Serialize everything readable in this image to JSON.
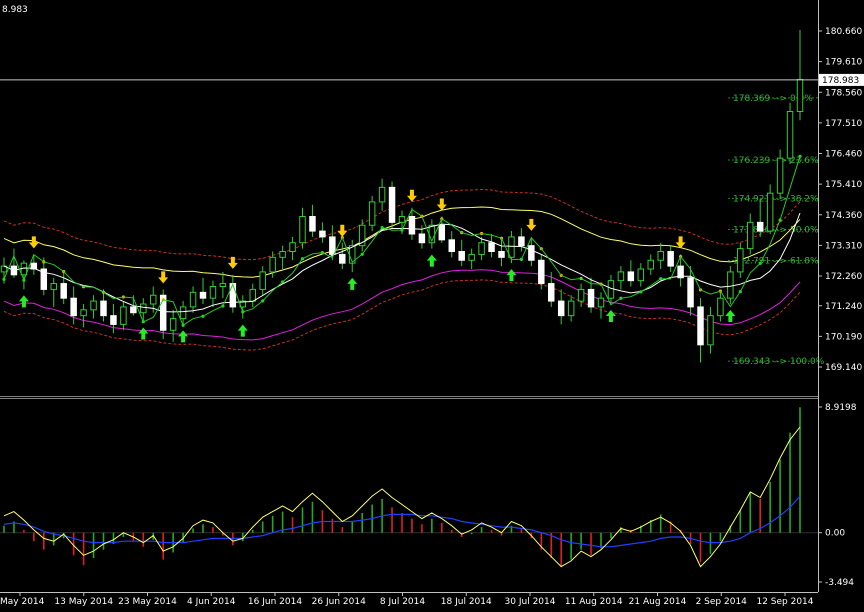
{
  "chart_data": [
    {
      "type": "candlestick",
      "panel": "main",
      "corner_label": "8.983",
      "current_price_label": "178.983",
      "current_price": 178.983,
      "ylim": [
        169.14,
        181.0
      ],
      "y_ticks": [
        "180.660",
        "179.610",
        "178.560",
        "177.510",
        "176.460",
        "175.410",
        "174.360",
        "173.310",
        "172.260",
        "171.240",
        "170.190",
        "169.140"
      ],
      "y_tick_values": [
        180.66,
        179.61,
        178.56,
        177.51,
        176.46,
        175.41,
        174.36,
        173.31,
        172.26,
        171.24,
        170.19,
        169.14
      ],
      "fib_levels": [
        {
          "label": "178.369 --> 0.0%",
          "value": 178.369
        },
        {
          "label": "176.239 --> 23.6%",
          "value": 176.239
        },
        {
          "label": "174.921 --> 38.2%",
          "value": 174.921
        },
        {
          "label": "173.856 --> 50.0%",
          "value": 173.856
        },
        {
          "label": "172.791 --> 61.8%",
          "value": 172.791
        },
        {
          "label": "169.343 --> 100.0%",
          "value": 169.343
        }
      ],
      "candles_ohlc": [
        [
          172.4,
          172.9,
          172.0,
          172.6
        ],
        [
          172.6,
          173.2,
          172.2,
          172.3
        ],
        [
          172.3,
          172.8,
          171.8,
          172.7
        ],
        [
          172.7,
          173.0,
          172.3,
          172.5
        ],
        [
          172.5,
          172.9,
          171.6,
          171.8
        ],
        [
          171.8,
          172.2,
          171.2,
          172.0
        ],
        [
          172.0,
          172.4,
          171.3,
          171.5
        ],
        [
          171.5,
          171.9,
          170.6,
          170.9
        ],
        [
          170.9,
          171.3,
          170.5,
          171.1
        ],
        [
          171.1,
          171.6,
          170.8,
          171.4
        ],
        [
          171.4,
          171.8,
          170.7,
          170.9
        ],
        [
          170.9,
          171.3,
          170.3,
          170.6
        ],
        [
          170.6,
          171.4,
          170.4,
          171.2
        ],
        [
          171.2,
          171.6,
          170.9,
          171.0
        ],
        [
          171.0,
          171.5,
          170.7,
          171.3
        ],
        [
          171.3,
          171.9,
          171.0,
          171.6
        ],
        [
          171.6,
          171.8,
          170.1,
          170.4
        ],
        [
          170.4,
          171.1,
          170.0,
          170.8
        ],
        [
          170.8,
          171.4,
          170.6,
          171.2
        ],
        [
          171.2,
          171.9,
          171.0,
          171.7
        ],
        [
          171.7,
          172.2,
          171.3,
          171.5
        ],
        [
          171.5,
          172.1,
          171.2,
          171.9
        ],
        [
          171.9,
          172.4,
          171.5,
          172.0
        ],
        [
          172.0,
          172.3,
          171.0,
          171.2
        ],
        [
          171.2,
          171.6,
          170.8,
          171.4
        ],
        [
          171.4,
          172.0,
          171.2,
          171.8
        ],
        [
          171.8,
          172.6,
          171.6,
          172.4
        ],
        [
          172.4,
          173.1,
          172.2,
          172.9
        ],
        [
          172.9,
          173.3,
          172.5,
          173.1
        ],
        [
          173.1,
          173.6,
          172.8,
          173.4
        ],
        [
          173.4,
          174.6,
          173.2,
          174.3
        ],
        [
          174.3,
          174.7,
          173.6,
          173.8
        ],
        [
          173.8,
          174.1,
          173.4,
          173.6
        ],
        [
          173.6,
          174.0,
          172.8,
          173.0
        ],
        [
          173.0,
          173.4,
          172.5,
          172.7
        ],
        [
          172.7,
          173.5,
          172.4,
          173.3
        ],
        [
          173.3,
          174.2,
          173.1,
          174.0
        ],
        [
          174.0,
          175.0,
          173.8,
          174.8
        ],
        [
          174.8,
          175.6,
          174.5,
          175.3
        ],
        [
          175.3,
          175.5,
          173.9,
          174.1
        ],
        [
          174.1,
          174.5,
          173.7,
          174.3
        ],
        [
          174.3,
          174.6,
          173.5,
          173.7
        ],
        [
          173.7,
          174.0,
          173.2,
          173.4
        ],
        [
          173.4,
          174.2,
          173.2,
          174.0
        ],
        [
          174.0,
          174.3,
          173.4,
          173.5
        ],
        [
          173.5,
          173.8,
          172.9,
          173.1
        ],
        [
          173.1,
          173.5,
          172.6,
          172.8
        ],
        [
          172.8,
          173.2,
          172.5,
          173.0
        ],
        [
          173.0,
          173.6,
          172.8,
          173.4
        ],
        [
          173.4,
          173.7,
          172.9,
          173.1
        ],
        [
          173.1,
          173.5,
          172.6,
          172.9
        ],
        [
          172.9,
          173.8,
          172.7,
          173.6
        ],
        [
          173.6,
          173.9,
          173.1,
          173.3
        ],
        [
          173.3,
          173.6,
          172.6,
          172.8
        ],
        [
          172.8,
          173.0,
          171.8,
          172.0
        ],
        [
          172.0,
          172.4,
          171.2,
          171.4
        ],
        [
          171.4,
          171.8,
          170.6,
          170.9
        ],
        [
          170.9,
          171.6,
          170.7,
          171.4
        ],
        [
          171.4,
          172.0,
          171.2,
          171.8
        ],
        [
          171.8,
          172.2,
          171.0,
          171.2
        ],
        [
          171.2,
          171.7,
          170.8,
          171.5
        ],
        [
          171.5,
          172.3,
          171.3,
          172.1
        ],
        [
          172.1,
          172.6,
          171.8,
          172.4
        ],
        [
          172.4,
          172.8,
          171.9,
          172.1
        ],
        [
          172.1,
          172.7,
          171.9,
          172.5
        ],
        [
          172.5,
          173.0,
          172.3,
          172.8
        ],
        [
          172.8,
          173.4,
          172.5,
          173.1
        ],
        [
          173.1,
          173.3,
          172.4,
          172.6
        ],
        [
          172.6,
          173.0,
          171.9,
          172.2
        ],
        [
          172.2,
          172.6,
          170.9,
          171.2
        ],
        [
          171.2,
          171.5,
          169.3,
          169.9
        ],
        [
          169.9,
          171.2,
          169.6,
          170.9
        ],
        [
          170.9,
          171.7,
          170.7,
          171.5
        ],
        [
          171.5,
          172.6,
          171.3,
          172.4
        ],
        [
          172.4,
          173.4,
          172.2,
          173.2
        ],
        [
          173.2,
          174.4,
          173.0,
          174.1
        ],
        [
          174.1,
          174.9,
          173.6,
          173.8
        ],
        [
          173.8,
          175.4,
          173.7,
          175.1
        ],
        [
          175.1,
          176.6,
          174.9,
          176.3
        ],
        [
          176.3,
          178.2,
          176.1,
          177.9
        ],
        [
          177.9,
          180.7,
          177.6,
          179.0
        ]
      ]
    },
    {
      "type": "histogram_with_lines",
      "panel": "oscillator",
      "ylim": [
        -3.494,
        8.9198
      ],
      "y_ticks": [
        "8.9198",
        "0.00",
        "-3.494"
      ],
      "y_tick_values": [
        8.9198,
        0.0,
        -3.494
      ],
      "x_tick_labels": [
        "May 2014",
        "13 May 2014",
        "23 May 2014",
        "4 Jun 2014",
        "16 Jun 2014",
        "26 Jun 2014",
        "8 Jul 2014",
        "18 Jul 2014",
        "30 Jul 2014",
        "11 Aug 2014",
        "21 Aug 2014",
        "2 Sep 2014",
        "12 Sep 2014"
      ],
      "histogram": [
        0.5,
        0.8,
        0.2,
        -0.6,
        -1.2,
        -0.9,
        -0.4,
        -1.6,
        -2.3,
        -1.8,
        -1.2,
        -0.8,
        -0.3,
        -0.6,
        -1.0,
        -0.5,
        -1.9,
        -1.4,
        -0.7,
        0.3,
        0.6,
        0.4,
        -0.2,
        -0.9,
        -0.6,
        0.2,
        0.8,
        1.2,
        1.5,
        1.1,
        1.8,
        2.2,
        1.6,
        1.0,
        0.4,
        0.8,
        1.4,
        2.0,
        2.4,
        1.8,
        1.4,
        1.0,
        0.6,
        1.0,
        0.7,
        0.2,
        -0.3,
        -0.1,
        0.4,
        0.2,
        -0.2,
        0.5,
        0.3,
        -0.4,
        -1.2,
        -1.8,
        -2.4,
        -1.9,
        -1.2,
        -1.6,
        -1.1,
        -0.4,
        0.4,
        0.2,
        0.5,
        0.9,
        1.3,
        0.8,
        0.2,
        -0.8,
        -2.1,
        -1.5,
        -0.6,
        0.5,
        1.6,
        2.9,
        2.4,
        3.6,
        5.2,
        7.1,
        8.9
      ],
      "signal_line": [
        0.6,
        0.7,
        0.6,
        0.4,
        0.1,
        -0.1,
        -0.2,
        -0.4,
        -0.6,
        -0.7,
        -0.7,
        -0.7,
        -0.6,
        -0.6,
        -0.6,
        -0.6,
        -0.7,
        -0.7,
        -0.7,
        -0.6,
        -0.5,
        -0.4,
        -0.4,
        -0.4,
        -0.4,
        -0.3,
        -0.2,
        0.0,
        0.2,
        0.3,
        0.5,
        0.7,
        0.8,
        0.8,
        0.8,
        0.8,
        0.9,
        1.0,
        1.2,
        1.3,
        1.3,
        1.3,
        1.2,
        1.2,
        1.1,
        1.0,
        0.8,
        0.7,
        0.6,
        0.5,
        0.4,
        0.4,
        0.3,
        0.2,
        0.0,
        -0.2,
        -0.5,
        -0.7,
        -0.8,
        -0.9,
        -1.0,
        -1.0,
        -0.9,
        -0.8,
        -0.7,
        -0.6,
        -0.4,
        -0.3,
        -0.3,
        -0.4,
        -0.6,
        -0.7,
        -0.7,
        -0.6,
        -0.4,
        0.0,
        0.3,
        0.7,
        1.2,
        1.8,
        2.6
      ],
      "oscillator_line": [
        1.2,
        1.5,
        0.9,
        0.2,
        -0.4,
        -0.6,
        -0.1,
        -0.9,
        -1.6,
        -1.3,
        -0.8,
        -0.5,
        0.0,
        -0.3,
        -0.7,
        -0.2,
        -1.3,
        -1.0,
        -0.4,
        0.5,
        0.9,
        0.7,
        0.0,
        -0.6,
        -0.4,
        0.4,
        1.1,
        1.5,
        1.9,
        1.5,
        2.2,
        2.8,
        2.2,
        1.5,
        0.8,
        1.2,
        1.9,
        2.6,
        3.1,
        2.5,
        2.0,
        1.5,
        1.0,
        1.4,
        1.0,
        0.5,
        -0.1,
        0.2,
        0.7,
        0.4,
        0.0,
        0.8,
        0.5,
        -0.2,
        -1.0,
        -1.7,
        -2.4,
        -2.0,
        -1.3,
        -1.7,
        -1.2,
        -0.5,
        0.3,
        0.1,
        0.4,
        0.8,
        1.1,
        0.7,
        0.1,
        -0.9,
        -2.4,
        -1.7,
        -0.8,
        0.4,
        1.6,
        2.9,
        2.5,
        3.8,
        5.3,
        6.6,
        7.5
      ]
    }
  ]
}
